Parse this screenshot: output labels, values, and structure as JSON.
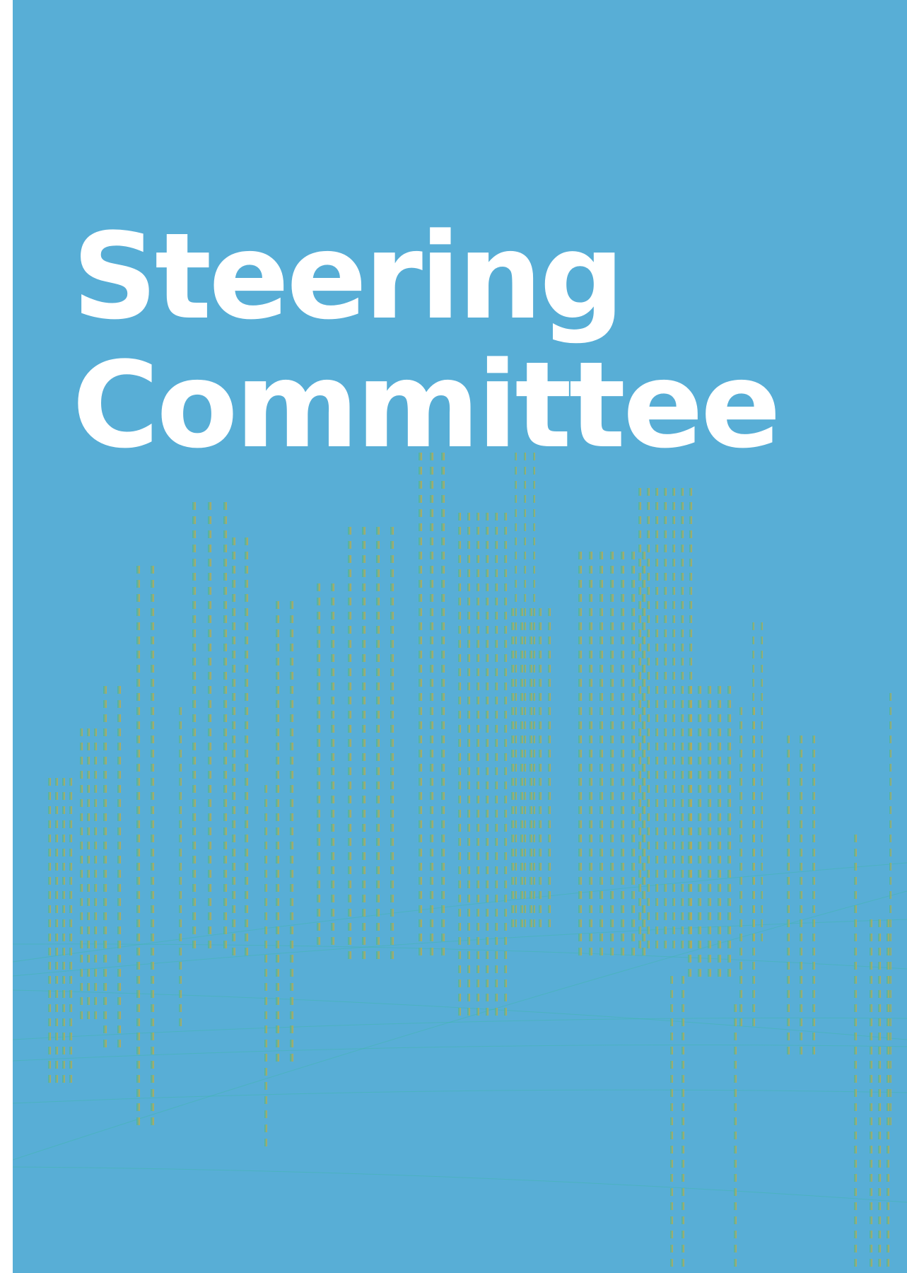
{
  "cover": {
    "title_line_1": "Steering",
    "title_line_2": "Committee"
  },
  "colors": {
    "background": "#58aed6",
    "title": "#ffffff",
    "pattern_gold": "#c9a948",
    "pattern_teal": "#3fb8a8"
  },
  "decorations": {
    "skyline_pattern": "city-skyline-dotted-pattern"
  }
}
